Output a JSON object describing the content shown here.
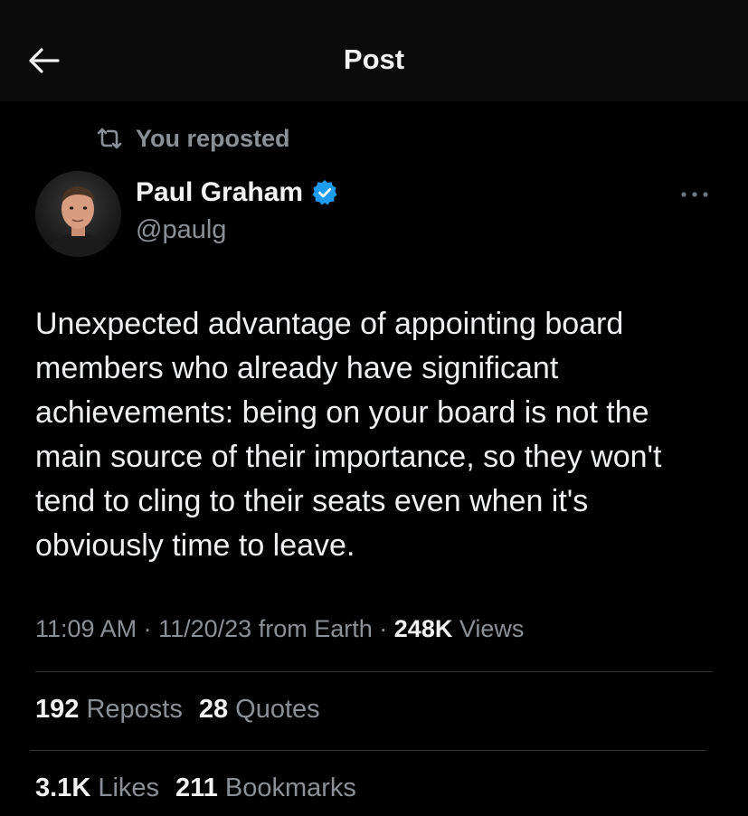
{
  "header": {
    "title": "Post"
  },
  "repost": {
    "label": "You reposted"
  },
  "author": {
    "name": "Paul Graham",
    "handle": "@paulg"
  },
  "tweet": {
    "text": "Unexpected advantage of appointing board members who already have significant achievements: being on your board is not the main source of their importance, so they won't tend to cling to their seats even when it's obviously time to leave."
  },
  "meta": {
    "time": "11:09 AM",
    "date": "11/20/23",
    "source": "from Earth",
    "views_count": "248K",
    "views_label": "Views"
  },
  "stats": {
    "reposts_count": "192",
    "reposts_label": "Reposts",
    "quotes_count": "28",
    "quotes_label": "Quotes",
    "likes_count": "3.1K",
    "likes_label": "Likes",
    "bookmarks_count": "211",
    "bookmarks_label": "Bookmarks"
  },
  "colors": {
    "background": "#000000",
    "secondary_text": "#8b9096",
    "verified_blue": "#1d9bf0",
    "divider": "#2f3336"
  },
  "icons": {
    "back": "arrow-left-icon",
    "repost": "repost-icon",
    "verified": "verified-badge-icon",
    "more": "more-horizontal-icon"
  }
}
